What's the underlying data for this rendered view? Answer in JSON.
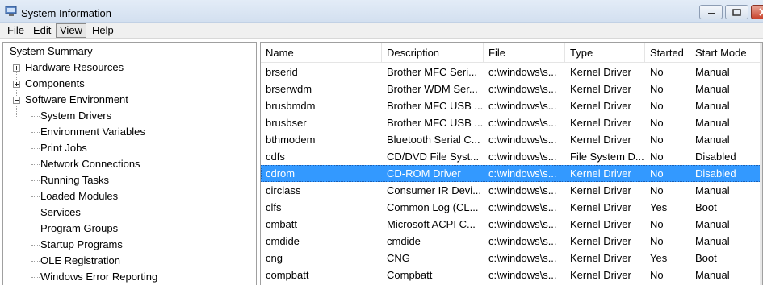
{
  "window": {
    "title": "System Information"
  },
  "menu": [
    "File",
    "Edit",
    "View",
    "Help"
  ],
  "tree": {
    "root": "System Summary",
    "groups": [
      "Hardware Resources",
      "Components",
      "Software Environment"
    ],
    "software_environment_children": [
      "System Drivers",
      "Environment Variables",
      "Print Jobs",
      "Network Connections",
      "Running Tasks",
      "Loaded Modules",
      "Services",
      "Program Groups",
      "Startup Programs",
      "OLE Registration",
      "Windows Error Reporting"
    ]
  },
  "table": {
    "columns": [
      "Name",
      "Description",
      "File",
      "Type",
      "Started",
      "Start Mode"
    ],
    "selected_row": 6,
    "rows": [
      [
        "brserid",
        "Brother MFC Seri...",
        "c:\\windows\\s...",
        "Kernel Driver",
        "No",
        "Manual"
      ],
      [
        "brserwdm",
        "Brother WDM Ser...",
        "c:\\windows\\s...",
        "Kernel Driver",
        "No",
        "Manual"
      ],
      [
        "brusbmdm",
        "Brother MFC USB ...",
        "c:\\windows\\s...",
        "Kernel Driver",
        "No",
        "Manual"
      ],
      [
        "brusbser",
        "Brother MFC USB ...",
        "c:\\windows\\s...",
        "Kernel Driver",
        "No",
        "Manual"
      ],
      [
        "bthmodem",
        "Bluetooth Serial C...",
        "c:\\windows\\s...",
        "Kernel Driver",
        "No",
        "Manual"
      ],
      [
        "cdfs",
        "CD/DVD File Syst...",
        "c:\\windows\\s...",
        "File System D...",
        "No",
        "Disabled"
      ],
      [
        "cdrom",
        "CD-ROM Driver",
        "c:\\windows\\s...",
        "Kernel Driver",
        "No",
        "Disabled"
      ],
      [
        "circlass",
        "Consumer IR Devi...",
        "c:\\windows\\s...",
        "Kernel Driver",
        "No",
        "Manual"
      ],
      [
        "clfs",
        "Common Log (CL...",
        "c:\\windows\\s...",
        "Kernel Driver",
        "Yes",
        "Boot"
      ],
      [
        "cmbatt",
        "Microsoft ACPI C...",
        "c:\\windows\\s...",
        "Kernel Driver",
        "No",
        "Manual"
      ],
      [
        "cmdide",
        "cmdide",
        "c:\\windows\\s...",
        "Kernel Driver",
        "No",
        "Manual"
      ],
      [
        "cng",
        "CNG",
        "c:\\windows\\s...",
        "Kernel Driver",
        "Yes",
        "Boot"
      ],
      [
        "compbatt",
        "Compbatt",
        "c:\\windows\\s...",
        "Kernel Driver",
        "No",
        "Manual"
      ]
    ]
  },
  "icons": {
    "app": "system-info-icon",
    "expander_plus": "plus-expander-icon",
    "expander_minus": "minus-expander-icon"
  },
  "colors": {
    "selection": "#3399ff",
    "titlebar": "#dce7f4",
    "close_button": "#c9432c"
  }
}
